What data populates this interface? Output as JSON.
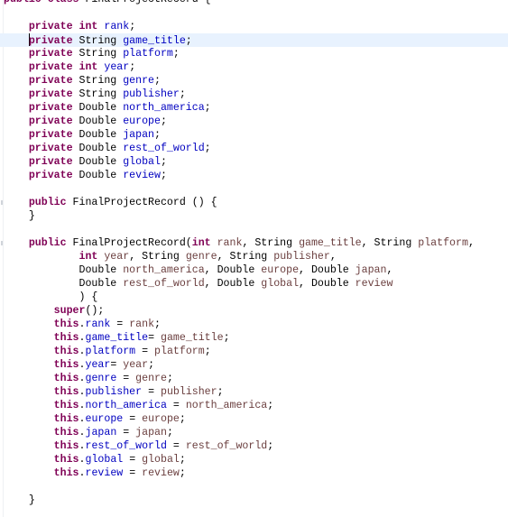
{
  "editor": {
    "language": "java",
    "class_name": "FinalProjectRecord",
    "caret_line": 2,
    "highlighted_line": 2,
    "colors": {
      "keyword": "#7f0055",
      "field": "#0000c0",
      "parameter": "#6a3e3e",
      "current_line": "#e8f2fe"
    },
    "lines": [
      {
        "indent": "",
        "tokens": [
          [
            "kw",
            "public"
          ],
          [
            "t",
            " "
          ],
          [
            "kw",
            "class"
          ],
          [
            "t",
            " FinalProjectRecord {"
          ]
        ]
      },
      {
        "indent": "",
        "tokens": []
      },
      {
        "indent": "    ",
        "tokens": [
          [
            "kw",
            "private"
          ],
          [
            "t",
            " "
          ],
          [
            "kw",
            "int"
          ],
          [
            "t",
            " "
          ],
          [
            "fld",
            "rank"
          ],
          [
            "t",
            ";"
          ]
        ]
      },
      {
        "indent": "    ",
        "caret": true,
        "highlight": true,
        "tokens": [
          [
            "kw",
            "private"
          ],
          [
            "t",
            " String "
          ],
          [
            "fld",
            "game_title"
          ],
          [
            "t",
            ";"
          ]
        ]
      },
      {
        "indent": "    ",
        "tokens": [
          [
            "kw",
            "private"
          ],
          [
            "t",
            " String "
          ],
          [
            "fld",
            "platform"
          ],
          [
            "t",
            ";"
          ]
        ]
      },
      {
        "indent": "    ",
        "tokens": [
          [
            "kw",
            "private"
          ],
          [
            "t",
            " "
          ],
          [
            "kw",
            "int"
          ],
          [
            "t",
            " "
          ],
          [
            "fld",
            "year"
          ],
          [
            "t",
            ";"
          ]
        ]
      },
      {
        "indent": "    ",
        "tokens": [
          [
            "kw",
            "private"
          ],
          [
            "t",
            " String "
          ],
          [
            "fld",
            "genre"
          ],
          [
            "t",
            ";"
          ]
        ]
      },
      {
        "indent": "    ",
        "tokens": [
          [
            "kw",
            "private"
          ],
          [
            "t",
            " String "
          ],
          [
            "fld",
            "publisher"
          ],
          [
            "t",
            ";"
          ]
        ]
      },
      {
        "indent": "    ",
        "tokens": [
          [
            "kw",
            "private"
          ],
          [
            "t",
            " Double "
          ],
          [
            "fld",
            "north_america"
          ],
          [
            "t",
            ";"
          ]
        ]
      },
      {
        "indent": "    ",
        "tokens": [
          [
            "kw",
            "private"
          ],
          [
            "t",
            " Double "
          ],
          [
            "fld",
            "europe"
          ],
          [
            "t",
            ";"
          ]
        ]
      },
      {
        "indent": "    ",
        "tokens": [
          [
            "kw",
            "private"
          ],
          [
            "t",
            " Double "
          ],
          [
            "fld",
            "japan"
          ],
          [
            "t",
            ";"
          ]
        ]
      },
      {
        "indent": "    ",
        "tokens": [
          [
            "kw",
            "private"
          ],
          [
            "t",
            " Double "
          ],
          [
            "fld",
            "rest_of_world"
          ],
          [
            "t",
            ";"
          ]
        ]
      },
      {
        "indent": "    ",
        "tokens": [
          [
            "kw",
            "private"
          ],
          [
            "t",
            " Double "
          ],
          [
            "fld",
            "global"
          ],
          [
            "t",
            ";"
          ]
        ]
      },
      {
        "indent": "    ",
        "tokens": [
          [
            "kw",
            "private"
          ],
          [
            "t",
            " Double "
          ],
          [
            "fld",
            "review"
          ],
          [
            "t",
            ";"
          ]
        ]
      },
      {
        "indent": "",
        "tokens": []
      },
      {
        "indent": "    ",
        "marker": true,
        "tokens": [
          [
            "kw",
            "public"
          ],
          [
            "t",
            " FinalProjectRecord () {"
          ]
        ]
      },
      {
        "indent": "    ",
        "tokens": [
          [
            "t",
            "}"
          ]
        ]
      },
      {
        "indent": "",
        "tokens": []
      },
      {
        "indent": "    ",
        "marker": true,
        "tokens": [
          [
            "kw",
            "public"
          ],
          [
            "t",
            " FinalProjectRecord("
          ],
          [
            "kw",
            "int"
          ],
          [
            "t",
            " "
          ],
          [
            "prm",
            "rank"
          ],
          [
            "t",
            ", String "
          ],
          [
            "prm",
            "game_title"
          ],
          [
            "t",
            ", String "
          ],
          [
            "prm",
            "platform"
          ],
          [
            "t",
            ","
          ]
        ]
      },
      {
        "indent": "            ",
        "tokens": [
          [
            "kw",
            "int"
          ],
          [
            "t",
            " "
          ],
          [
            "prm",
            "year"
          ],
          [
            "t",
            ", String "
          ],
          [
            "prm",
            "genre"
          ],
          [
            "t",
            ", String "
          ],
          [
            "prm",
            "publisher"
          ],
          [
            "t",
            ","
          ]
        ]
      },
      {
        "indent": "            ",
        "tokens": [
          [
            "t",
            "Double "
          ],
          [
            "prm",
            "north_america"
          ],
          [
            "t",
            ", Double "
          ],
          [
            "prm",
            "europe"
          ],
          [
            "t",
            ", Double "
          ],
          [
            "prm",
            "japan"
          ],
          [
            "t",
            ","
          ]
        ]
      },
      {
        "indent": "            ",
        "tokens": [
          [
            "t",
            "Double "
          ],
          [
            "prm",
            "rest_of_world"
          ],
          [
            "t",
            ", Double "
          ],
          [
            "prm",
            "global"
          ],
          [
            "t",
            ", Double "
          ],
          [
            "prm",
            "review"
          ]
        ]
      },
      {
        "indent": "            ",
        "tokens": [
          [
            "t",
            ") {"
          ]
        ]
      },
      {
        "indent": "        ",
        "tokens": [
          [
            "kw",
            "super"
          ],
          [
            "t",
            "();"
          ]
        ]
      },
      {
        "indent": "        ",
        "tokens": [
          [
            "kw",
            "this"
          ],
          [
            "t",
            "."
          ],
          [
            "fld",
            "rank"
          ],
          [
            "t",
            " = "
          ],
          [
            "prm",
            "rank"
          ],
          [
            "t",
            ";"
          ]
        ]
      },
      {
        "indent": "        ",
        "tokens": [
          [
            "kw",
            "this"
          ],
          [
            "t",
            "."
          ],
          [
            "fld",
            "game_title"
          ],
          [
            "t",
            "= "
          ],
          [
            "prm",
            "game_title"
          ],
          [
            "t",
            ";"
          ]
        ]
      },
      {
        "indent": "        ",
        "tokens": [
          [
            "kw",
            "this"
          ],
          [
            "t",
            "."
          ],
          [
            "fld",
            "platform"
          ],
          [
            "t",
            " = "
          ],
          [
            "prm",
            "platform"
          ],
          [
            "t",
            ";"
          ]
        ]
      },
      {
        "indent": "        ",
        "tokens": [
          [
            "kw",
            "this"
          ],
          [
            "t",
            "."
          ],
          [
            "fld",
            "year"
          ],
          [
            "t",
            "= "
          ],
          [
            "prm",
            "year"
          ],
          [
            "t",
            ";"
          ]
        ]
      },
      {
        "indent": "        ",
        "tokens": [
          [
            "kw",
            "this"
          ],
          [
            "t",
            "."
          ],
          [
            "fld",
            "genre"
          ],
          [
            "t",
            " = "
          ],
          [
            "prm",
            "genre"
          ],
          [
            "t",
            ";"
          ]
        ]
      },
      {
        "indent": "        ",
        "tokens": [
          [
            "kw",
            "this"
          ],
          [
            "t",
            "."
          ],
          [
            "fld",
            "publisher"
          ],
          [
            "t",
            " = "
          ],
          [
            "prm",
            "publisher"
          ],
          [
            "t",
            ";"
          ]
        ]
      },
      {
        "indent": "        ",
        "tokens": [
          [
            "kw",
            "this"
          ],
          [
            "t",
            "."
          ],
          [
            "fld",
            "north_america"
          ],
          [
            "t",
            " = "
          ],
          [
            "prm",
            "north_america"
          ],
          [
            "t",
            ";"
          ]
        ]
      },
      {
        "indent": "        ",
        "tokens": [
          [
            "kw",
            "this"
          ],
          [
            "t",
            "."
          ],
          [
            "fld",
            "europe"
          ],
          [
            "t",
            " = "
          ],
          [
            "prm",
            "europe"
          ],
          [
            "t",
            ";"
          ]
        ]
      },
      {
        "indent": "        ",
        "tokens": [
          [
            "kw",
            "this"
          ],
          [
            "t",
            "."
          ],
          [
            "fld",
            "japan"
          ],
          [
            "t",
            " = "
          ],
          [
            "prm",
            "japan"
          ],
          [
            "t",
            ";"
          ]
        ]
      },
      {
        "indent": "        ",
        "tokens": [
          [
            "kw",
            "this"
          ],
          [
            "t",
            "."
          ],
          [
            "fld",
            "rest_of_world"
          ],
          [
            "t",
            " = "
          ],
          [
            "prm",
            "rest_of_world"
          ],
          [
            "t",
            ";"
          ]
        ]
      },
      {
        "indent": "        ",
        "tokens": [
          [
            "kw",
            "this"
          ],
          [
            "t",
            "."
          ],
          [
            "fld",
            "global"
          ],
          [
            "t",
            " = "
          ],
          [
            "prm",
            "global"
          ],
          [
            "t",
            ";"
          ]
        ]
      },
      {
        "indent": "        ",
        "tokens": [
          [
            "kw",
            "this"
          ],
          [
            "t",
            "."
          ],
          [
            "fld",
            "review"
          ],
          [
            "t",
            " = "
          ],
          [
            "prm",
            "review"
          ],
          [
            "t",
            ";"
          ]
        ]
      },
      {
        "indent": "",
        "tokens": []
      },
      {
        "indent": "    ",
        "tokens": [
          [
            "t",
            "}"
          ]
        ]
      }
    ]
  }
}
